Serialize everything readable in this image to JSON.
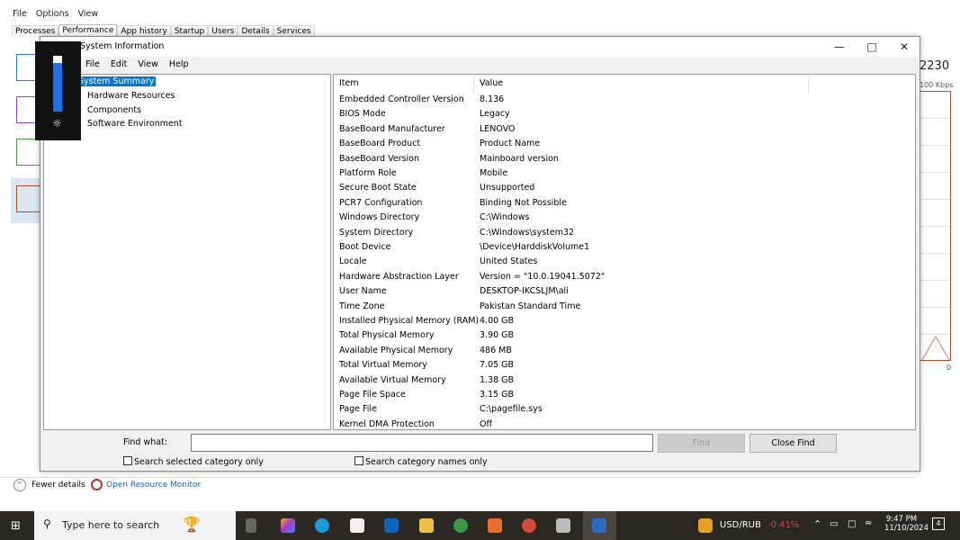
{
  "task_manager": {
    "menu": [
      "File",
      "Options",
      "View"
    ],
    "tabs": [
      "Processes",
      "Performance",
      "App history",
      "Startup",
      "Users",
      "Details",
      "Services"
    ],
    "active_tab": "Performance",
    "right_value": "2230",
    "right_scale": "100 Kbps",
    "right_zero": "0",
    "fewer_details": "Fewer details",
    "open_resource_monitor": "Open Resource Monitor"
  },
  "dialog": {
    "title": "System Information",
    "menu": [
      "File",
      "Edit",
      "View",
      "Help"
    ],
    "tree": [
      "System Summary",
      "Hardware Resources",
      "Components",
      "Software Environment"
    ],
    "selected": "System Summary",
    "columns": [
      "Item",
      "Value"
    ],
    "rows": [
      [
        "Embedded Controller Version",
        "8.136"
      ],
      [
        "BIOS Mode",
        "Legacy"
      ],
      [
        "BaseBoard Manufacturer",
        "LENOVO"
      ],
      [
        "BaseBoard Product",
        "Product Name"
      ],
      [
        "BaseBoard Version",
        "Mainboard version"
      ],
      [
        "Platform Role",
        "Mobile"
      ],
      [
        "Secure Boot State",
        "Unsupported"
      ],
      [
        "PCR7 Configuration",
        "Binding Not Possible"
      ],
      [
        "Windows Directory",
        "C:\\Windows"
      ],
      [
        "System Directory",
        "C:\\Windows\\system32"
      ],
      [
        "Boot Device",
        "\\Device\\HarddiskVolume1"
      ],
      [
        "Locale",
        "United States"
      ],
      [
        "Hardware Abstraction Layer",
        "Version = \"10.0.19041.5072\""
      ],
      [
        "User Name",
        "DESKTOP-IKCSLJM\\ali"
      ],
      [
        "Time Zone",
        "Pakistan Standard Time"
      ],
      [
        "Installed Physical Memory (RAM)",
        "4.00 GB"
      ],
      [
        "Total Physical Memory",
        "3.90 GB"
      ],
      [
        "Available Physical Memory",
        "486 MB"
      ],
      [
        "Total Virtual Memory",
        "7.05 GB"
      ],
      [
        "Available Virtual Memory",
        "1.38 GB"
      ],
      [
        "Page File Space",
        "3.15 GB"
      ],
      [
        "Page File",
        "C:\\pagefile.sys"
      ],
      [
        "Kernel DMA Protection",
        "Off"
      ]
    ],
    "find_label": "Find what:",
    "find_value": "",
    "find_button": "Find",
    "close_find_button": "Close Find",
    "search_selected": "Search selected category only",
    "search_names": "Search category names only"
  },
  "taskbar": {
    "search_placeholder": "Type here to search",
    "ticker": "USD/RUB",
    "ticker_change": "-0.41%",
    "ticker_change_color": "#e04040",
    "time": "9:47 PM",
    "date": "11/10/2024",
    "notifications": "4"
  }
}
